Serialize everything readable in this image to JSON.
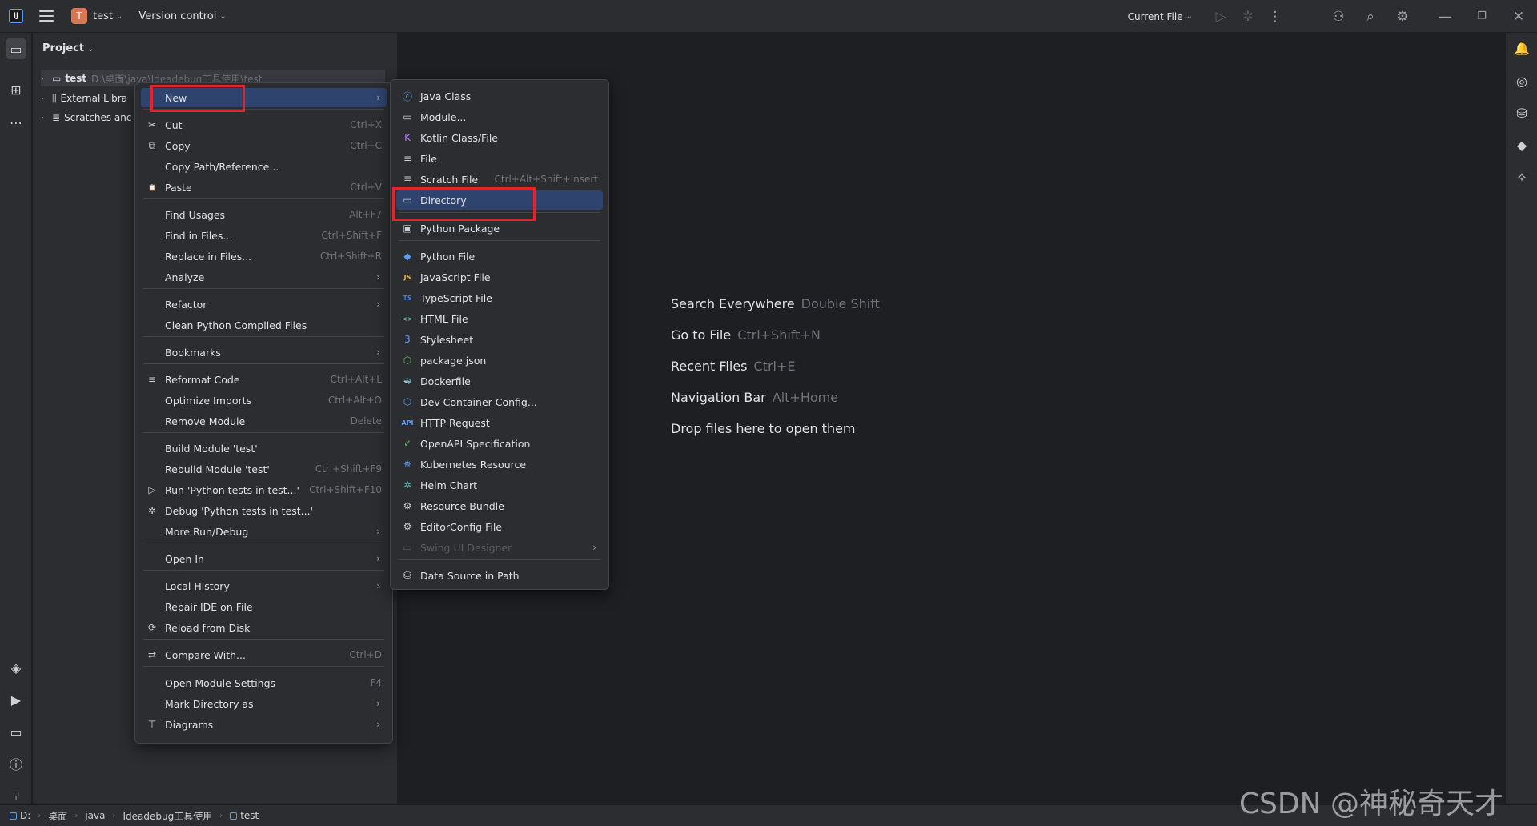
{
  "titlebar": {
    "project_initial": "T",
    "project_name": "test",
    "version_control": "Version control",
    "run_config": "Current File"
  },
  "project_panel": {
    "title": "Project",
    "tree": [
      {
        "label": "test",
        "hint": "D:\\桌面\\java\\Ideadebug工具使用\\test"
      },
      {
        "label": "External Libra"
      },
      {
        "label": "Scratches anc"
      }
    ]
  },
  "context_menu": [
    {
      "label": "New",
      "shortcut": "",
      "arrow": "›",
      "icon": ""
    },
    {
      "label": "Cut",
      "shortcut": "Ctrl+X",
      "icon": "✂"
    },
    {
      "label": "Copy",
      "shortcut": "Ctrl+C",
      "icon": "⧉"
    },
    {
      "label": "Copy Path/Reference...",
      "shortcut": "",
      "icon": ""
    },
    {
      "label": "Paste",
      "shortcut": "Ctrl+V",
      "icon": "📋"
    },
    {
      "label": "Find Usages",
      "shortcut": "Alt+F7",
      "icon": ""
    },
    {
      "label": "Find in Files...",
      "shortcut": "Ctrl+Shift+F",
      "icon": ""
    },
    {
      "label": "Replace in Files...",
      "shortcut": "Ctrl+Shift+R",
      "icon": ""
    },
    {
      "label": "Analyze",
      "shortcut": "",
      "arrow": "›",
      "icon": ""
    },
    {
      "label": "Refactor",
      "shortcut": "",
      "arrow": "›",
      "icon": ""
    },
    {
      "label": "Clean Python Compiled Files",
      "shortcut": "",
      "icon": ""
    },
    {
      "label": "Bookmarks",
      "shortcut": "",
      "arrow": "›",
      "icon": ""
    },
    {
      "label": "Reformat Code",
      "shortcut": "Ctrl+Alt+L",
      "icon": "≡"
    },
    {
      "label": "Optimize Imports",
      "shortcut": "Ctrl+Alt+O",
      "icon": ""
    },
    {
      "label": "Remove Module",
      "shortcut": "Delete",
      "icon": ""
    },
    {
      "label": "Build Module 'test'",
      "shortcut": "",
      "icon": ""
    },
    {
      "label": "Rebuild Module 'test'",
      "shortcut": "Ctrl+Shift+F9",
      "icon": ""
    },
    {
      "label": "Run 'Python tests in test...'",
      "shortcut": "Ctrl+Shift+F10",
      "icon": "▷"
    },
    {
      "label": "Debug 'Python tests in test...'",
      "shortcut": "",
      "icon": "✲"
    },
    {
      "label": "More Run/Debug",
      "shortcut": "",
      "arrow": "›",
      "icon": ""
    },
    {
      "label": "Open In",
      "shortcut": "",
      "arrow": "›",
      "icon": ""
    },
    {
      "label": "Local History",
      "shortcut": "",
      "arrow": "›",
      "icon": ""
    },
    {
      "label": "Repair IDE on File",
      "shortcut": "",
      "icon": ""
    },
    {
      "label": "Reload from Disk",
      "shortcut": "",
      "icon": "⟳"
    },
    {
      "label": "Compare With...",
      "shortcut": "Ctrl+D",
      "icon": "⇄"
    },
    {
      "label": "Open Module Settings",
      "shortcut": "F4",
      "icon": ""
    },
    {
      "label": "Mark Directory as",
      "shortcut": "",
      "arrow": "›",
      "icon": ""
    },
    {
      "label": "Diagrams",
      "shortcut": "",
      "arrow": "›",
      "icon": "⊤"
    }
  ],
  "new_submenu": [
    {
      "label": "Java Class",
      "shortcut": "",
      "icon": "ⓒ",
      "color": "#5a9cf8"
    },
    {
      "label": "Module...",
      "shortcut": "",
      "icon": "▭",
      "color": "#ced0d6"
    },
    {
      "label": "Kotlin Class/File",
      "shortcut": "",
      "icon": "K",
      "color": "#b07cff"
    },
    {
      "label": "File",
      "shortcut": "",
      "icon": "≡",
      "color": "#ced0d6"
    },
    {
      "label": "Scratch File",
      "shortcut": "Ctrl+Alt+Shift+Insert",
      "icon": "≣",
      "color": "#ced0d6"
    },
    {
      "label": "Directory",
      "shortcut": "",
      "icon": "▭",
      "color": "#ced0d6"
    },
    {
      "label": "Python Package",
      "shortcut": "",
      "icon": "▣",
      "color": "#ced0d6"
    },
    {
      "label": "Python File",
      "shortcut": "",
      "icon": "◆",
      "color": "#5a9cf8"
    },
    {
      "label": "JavaScript File",
      "shortcut": "",
      "icon": "JS",
      "color": "#e8b84a"
    },
    {
      "label": "TypeScript File",
      "shortcut": "",
      "icon": "TS",
      "color": "#3d7de0"
    },
    {
      "label": "HTML File",
      "shortcut": "",
      "icon": "<>",
      "color": "#4fb3a9"
    },
    {
      "label": "Stylesheet",
      "shortcut": "",
      "icon": "3",
      "color": "#5a9cf8"
    },
    {
      "label": "package.json",
      "shortcut": "",
      "icon": "⬡",
      "color": "#5fb865"
    },
    {
      "label": "Dockerfile",
      "shortcut": "",
      "icon": "🐳",
      "color": "#5a9cf8"
    },
    {
      "label": "Dev Container Config...",
      "shortcut": "",
      "icon": "⬡",
      "color": "#5a9cf8"
    },
    {
      "label": "HTTP Request",
      "shortcut": "",
      "icon": "API",
      "color": "#5a9cf8"
    },
    {
      "label": "OpenAPI Specification",
      "shortcut": "",
      "icon": "✓",
      "color": "#5fb865"
    },
    {
      "label": "Kubernetes Resource",
      "shortcut": "",
      "icon": "✵",
      "color": "#5a9cf8"
    },
    {
      "label": "Helm Chart",
      "shortcut": "",
      "icon": "✲",
      "color": "#4fb3a9"
    },
    {
      "label": "Resource Bundle",
      "shortcut": "",
      "icon": "⚙",
      "color": "#ced0d6"
    },
    {
      "label": "EditorConfig File",
      "shortcut": "",
      "icon": "⚙",
      "color": "#ced0d6"
    },
    {
      "label": "Swing UI Designer",
      "shortcut": "",
      "icon": "▭",
      "color": "#5a5d63",
      "disabled": true,
      "arrow": "›"
    },
    {
      "label": "Data Source in Path",
      "shortcut": "",
      "icon": "⛁",
      "color": "#ced0d6"
    }
  ],
  "editor_hints": [
    {
      "label": "Search Everywhere",
      "shortcut": "Double Shift"
    },
    {
      "label": "Go to File",
      "shortcut": "Ctrl+Shift+N"
    },
    {
      "label": "Recent Files",
      "shortcut": "Ctrl+E"
    },
    {
      "label": "Navigation Bar",
      "shortcut": "Alt+Home"
    },
    {
      "label": "Drop files here to open them",
      "shortcut": ""
    }
  ],
  "statusbar": {
    "breadcrumbs": [
      "D:",
      "桌面",
      "java",
      "Ideadebug工具使用",
      "test"
    ]
  },
  "watermark": "CSDN @神秘奇天才",
  "colors": {
    "highlight": "#2e436e",
    "annotation_red": "#e5232b",
    "accent": "#5a9cf8"
  }
}
